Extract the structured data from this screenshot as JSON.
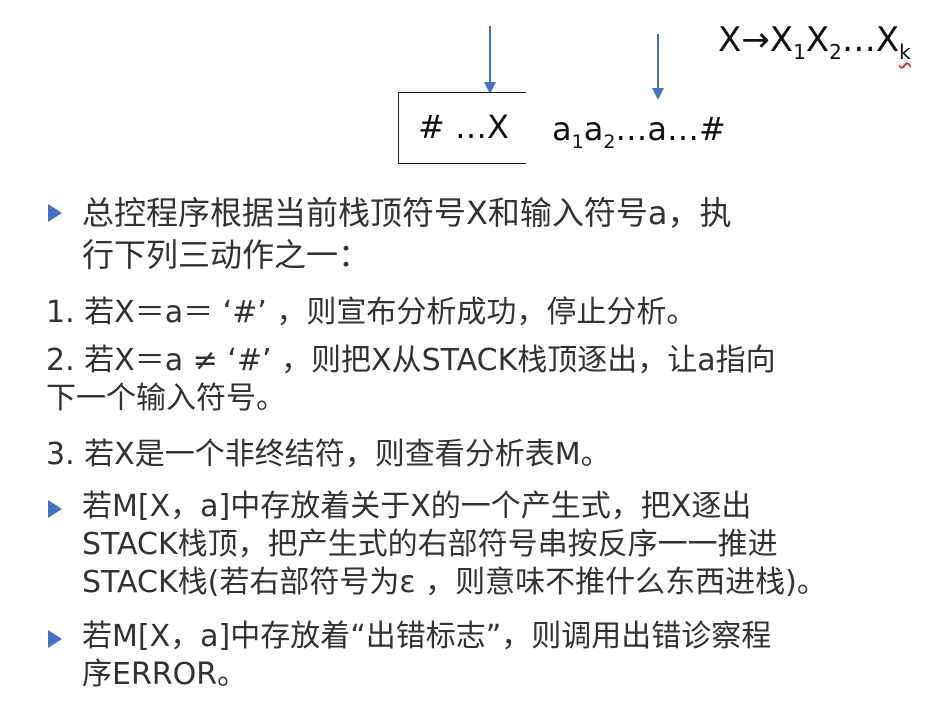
{
  "production": {
    "head": "X→X",
    "s1": "1",
    "mid1": "X",
    "s2": "2",
    "mid2": "…X",
    "sk": "k"
  },
  "stack": {
    "text": "# …X"
  },
  "input": {
    "a": "a",
    "s1": "1",
    "b": "a",
    "s2": "2",
    "rest": "…a…#"
  },
  "colors": {
    "bullet": "#4472c4",
    "arrow": "#4472c4",
    "text": "#333333"
  },
  "bullets": [
    {
      "lines": [
        "总控程序根据当前栈顶符号X和输入符号a，执",
        "行下列三动作之一："
      ]
    },
    {
      "lines": [
        "若M[X，a]中存放着关于X的一个产生式，把X逐出",
        "STACK栈顶，把产生式的右部符号串按反序一一推进",
        "STACK栈(若右部符号为ε ，则意味不推什么东西进栈)。"
      ]
    },
    {
      "lines": [
        "若M[X，a]中存放着“出错标志”，则调用出错诊察程",
        "序ERROR。"
      ]
    }
  ],
  "numbered": [
    {
      "lines": [
        "1. 若X＝a＝ ‘#’ ，则宣布分析成功，停止分析。"
      ]
    },
    {
      "lines": [
        "2. 若X＝a ≠ ‘#’ ，则把X从STACK栈顶逐出，让a指向",
        "下一个输入符号。"
      ]
    },
    {
      "lines": [
        "3. 若X是一个非终结符，则查看分析表M。"
      ]
    }
  ]
}
